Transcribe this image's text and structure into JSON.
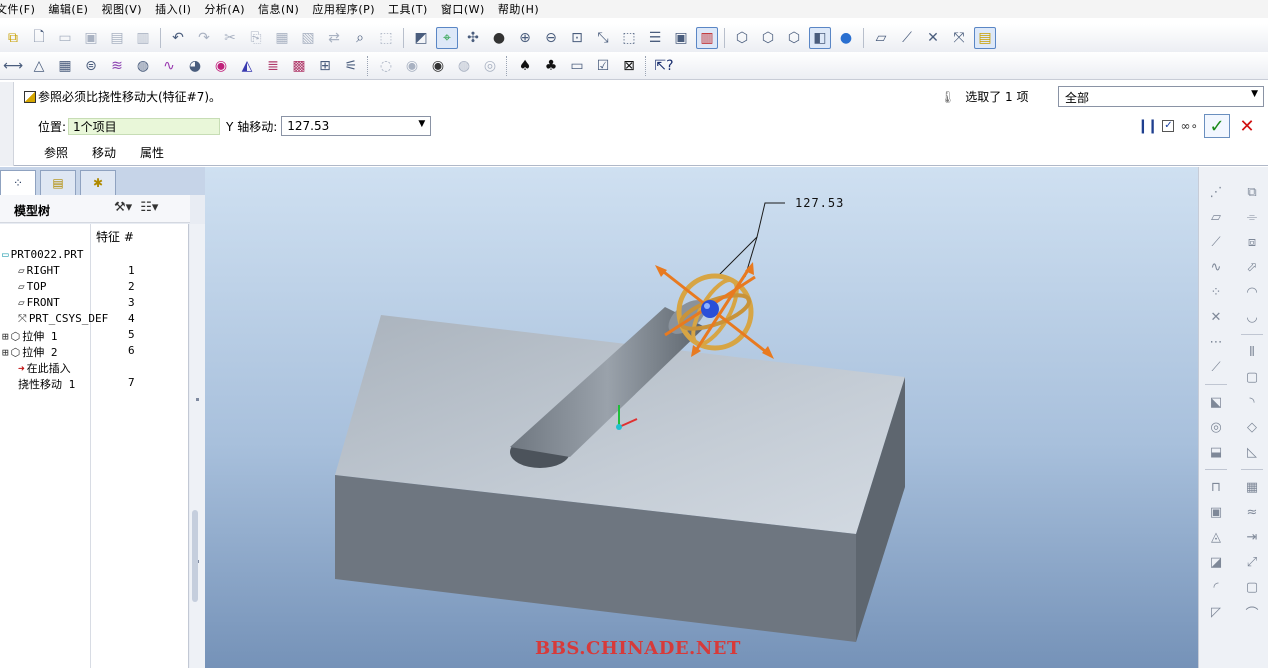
{
  "menu": [
    "文件(F)",
    "编辑(E)",
    "视图(V)",
    "插入(I)",
    "分析(A)",
    "信息(N)",
    "应用程序(P)",
    "工具(T)",
    "窗口(W)",
    "帮助(H)"
  ],
  "dashboard": {
    "message": "参照必须比挠性移动大(特征#7)。",
    "selected_text": "选取了 1 项",
    "filter_value": "全部",
    "position_label": "位置:",
    "position_value": "1个项目",
    "axis_label": "Y 轴移动:",
    "move_value": "127.53",
    "tabs": [
      "参照",
      "移动",
      "属性"
    ]
  },
  "navigator": {
    "title": "模型树",
    "col_feature": "特征 #",
    "items": [
      {
        "label": "PRT0022.PRT",
        "num": ""
      },
      {
        "label": "RIGHT",
        "num": "1"
      },
      {
        "label": "TOP",
        "num": "2"
      },
      {
        "label": "FRONT",
        "num": "3"
      },
      {
        "label": "PRT_CSYS_DEF",
        "num": "4"
      },
      {
        "label": "拉伸 1",
        "num": "5"
      },
      {
        "label": "拉伸 2",
        "num": "6"
      },
      {
        "label": "在此插入",
        "num": ""
      },
      {
        "label": "挠性移动 1",
        "num": "7"
      }
    ]
  },
  "viewport": {
    "dimension": "127.53",
    "watermark": "BBS.CHINADE.NET"
  },
  "colors": {
    "accent": "#3a6fb5",
    "ok": "#1a8a1a",
    "cancel": "#d01010",
    "watermark": "#d73a3a",
    "position_field": "#e9f7d9"
  },
  "icons": {
    "toolbar1": [
      "feature-icon",
      "new-file-icon",
      "open-icon",
      "save-icon",
      "save-copy-icon",
      "backup-icon",
      "undo-icon",
      "redo-icon",
      "cut-icon",
      "copy-icon",
      "paste-icon",
      "paste-special-icon",
      "regenerate-icon",
      "find-icon",
      "select-box-icon",
      "repaint-icon",
      "spin-center-icon",
      "orient-icon",
      "appearance-icon",
      "zoom-in-icon",
      "zoom-out-icon",
      "refit-icon",
      "reorient-icon",
      "saved-views-icon",
      "layers-icon",
      "view-manager-icon",
      "color-icon",
      "wireframe-icon",
      "hidden-line-icon",
      "no-hidden-icon",
      "shading-icon",
      "model-tree-icon",
      "plane-display-icon",
      "axis-display-icon",
      "point-display-icon",
      "csys-display-icon",
      "annotation-display-icon"
    ],
    "toolbar2": [
      "measure-length-icon",
      "measure-area-icon",
      "measure-table-icon",
      "mass-icon",
      "curvature-icon",
      "section-icon",
      "offset-icon",
      "shade-curvature-icon",
      "reflection-icon",
      "draft-icon",
      "slope-icon",
      "deviation-icon",
      "graph-icon",
      "dihedral-icon",
      "hide-icon",
      "show-icon",
      "unhide-icon",
      "view-icon",
      "visibility-icon",
      "spade-icon",
      "club-icon",
      "window-icon",
      "activate-icon",
      "close-window-icon",
      "help-icon"
    ]
  }
}
